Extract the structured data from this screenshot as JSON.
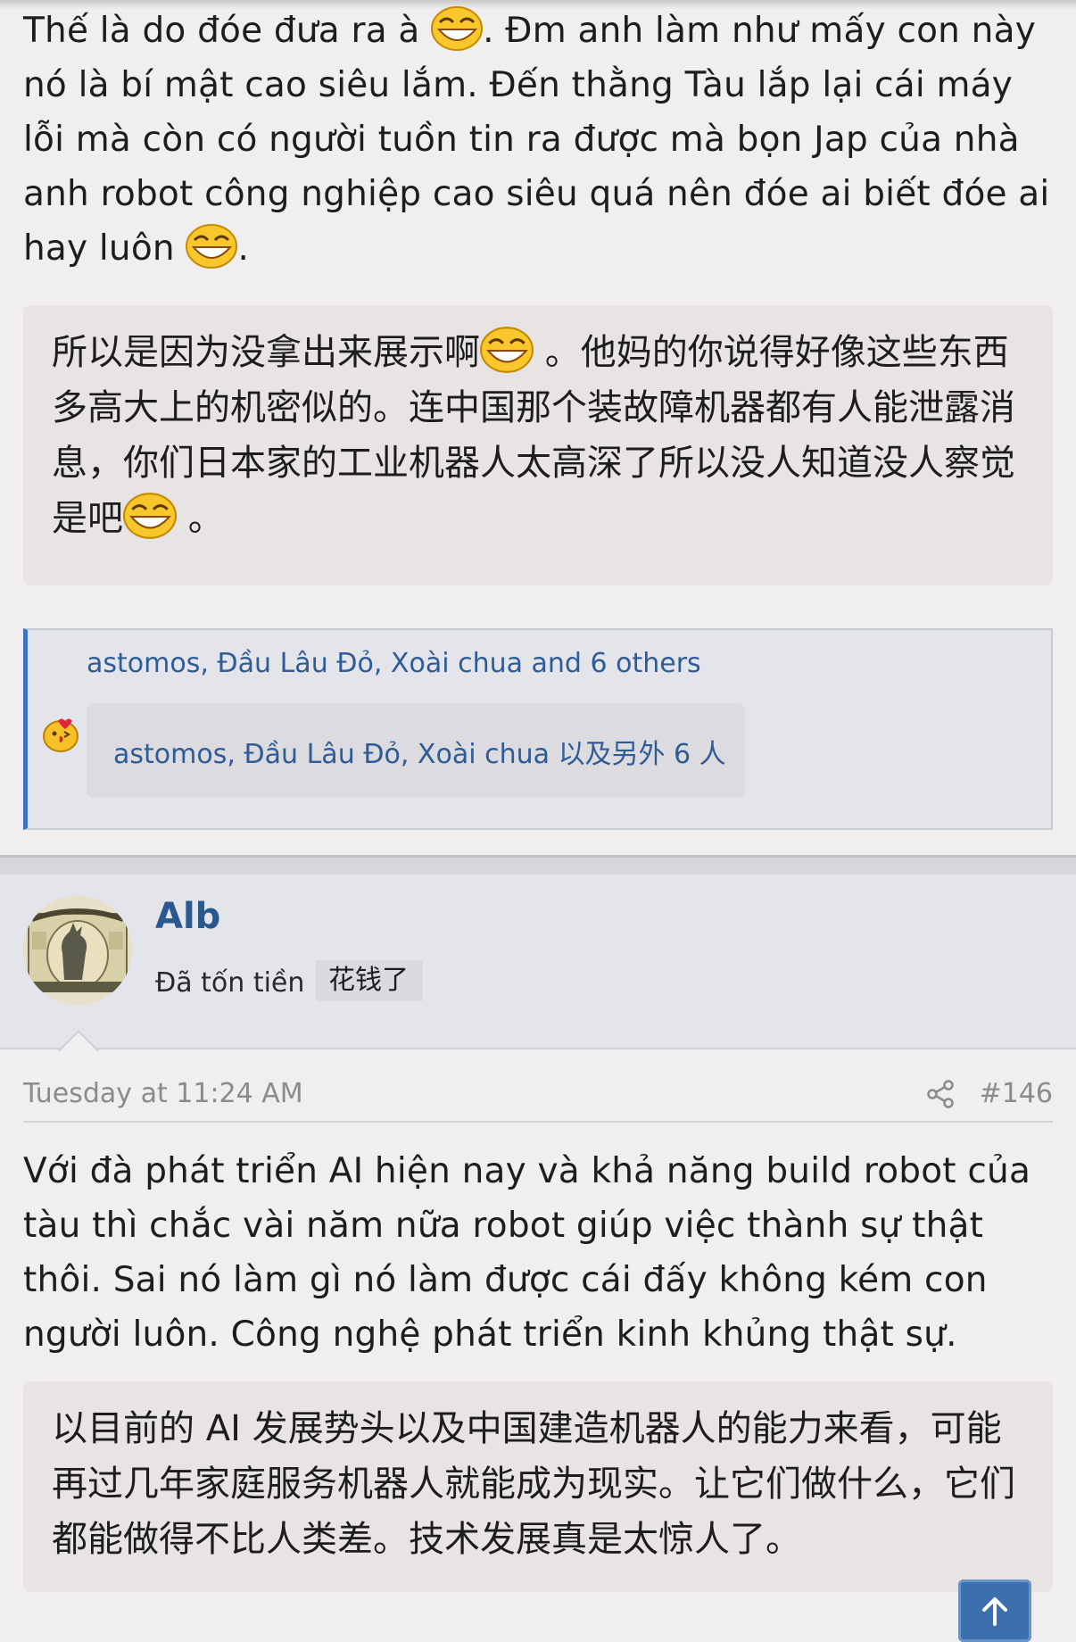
{
  "post1": {
    "text_before_emoji1": "Thế là do đóe đưa ra à ",
    "text_after_emoji1": ". Đm anh làm như mấy con này nó là bí mật cao siêu lắm. Đến thằng Tàu lắp lại cái máy lỗi mà còn có người tuồn tin ra được mà bọn Jap của nhà anh robot công nghiệp cao siêu quá nên đóe ai biết đóe ai hay luôn ",
    "text_end": ".",
    "translation_part1": "所以是因为没拿出来展示啊",
    "translation_part2": " 。他妈的你说得好像这些东西多高大上的机密似的。连中国那个装故障机器都有人能泄露消息，你们日本家的工业机器人太高深了所以没人知道没人察觉是吧",
    "translation_end": " 。",
    "emoji_icon": "laughing-face-icon"
  },
  "reactions": {
    "summary": "astomos, Đầu Lâu Đỏ, Xoài chua and 6 others",
    "summary_translation": "astomos, Đầu Lâu Đỏ, Xoài chua 以及另外 6 人",
    "icon": "kissing-face-icon"
  },
  "post2": {
    "username": "Alb",
    "user_title": "Đã tốn tiền",
    "user_title_translation": "花钱了",
    "timestamp": "Tuesday at 11:24 AM",
    "post_number": "#146",
    "body": "Với đà phát triển AI hiện nay và khả năng build robot của tàu thì chắc vài năm nữa robot giúp việc thành sự thật thôi. Sai nó làm gì nó làm được cái đấy không kém con người luôn. Công nghệ phát triển kinh khủng thật sự.",
    "translation": "以目前的 AI 发展势头以及中国建造机器人的能力来看，可能再过几年家庭服务机器人就能成为现实。让它们做什么，它们都能做得不比人类差。技术发展真是太惊人了。"
  },
  "colors": {
    "link": "#2f5c97",
    "username": "#2b578f",
    "accent_border": "#3d73c3",
    "background": "#f0eeee"
  }
}
